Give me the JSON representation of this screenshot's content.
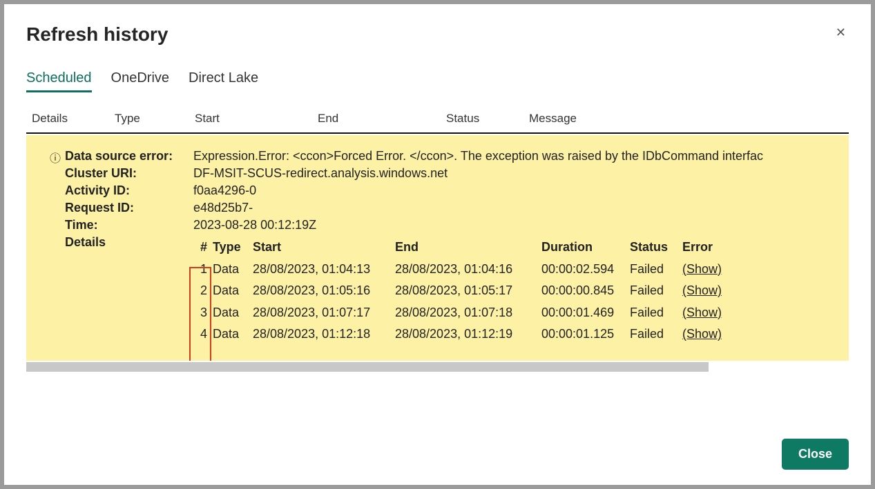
{
  "title": "Refresh history",
  "tabs": {
    "scheduled": "Scheduled",
    "onedrive": "OneDrive",
    "directlake": "Direct Lake"
  },
  "columns": {
    "details": "Details",
    "type": "Type",
    "start": "Start",
    "end": "End",
    "status": "Status",
    "message": "Message"
  },
  "error": {
    "labels": {
      "dse": "Data source error:",
      "cluster": "Cluster URI:",
      "activity": "Activity ID:",
      "request": "Request ID:",
      "time": "Time:",
      "details": "Details"
    },
    "values": {
      "dse": "Expression.Error: <ccon>Forced Error. </ccon>. The exception was raised by the IDbCommand interfac",
      "cluster": "DF-MSIT-SCUS-redirect.analysis.windows.net",
      "activity": "f0aa4296-0",
      "request": "e48d25b7-",
      "time": "2023-08-28 00:12:19Z"
    },
    "table": {
      "head": {
        "num": "#",
        "type": "Type",
        "start": "Start",
        "end": "End",
        "dur": "Duration",
        "stat": "Status",
        "err": "Error"
      },
      "rows": [
        {
          "num": "1",
          "type": "Data",
          "start": "28/08/2023, 01:04:13",
          "end": "28/08/2023, 01:04:16",
          "dur": "00:00:02.594",
          "stat": "Failed",
          "err": "(Show)"
        },
        {
          "num": "2",
          "type": "Data",
          "start": "28/08/2023, 01:05:16",
          "end": "28/08/2023, 01:05:17",
          "dur": "00:00:00.845",
          "stat": "Failed",
          "err": "(Show)"
        },
        {
          "num": "3",
          "type": "Data",
          "start": "28/08/2023, 01:07:17",
          "end": "28/08/2023, 01:07:18",
          "dur": "00:00:01.469",
          "stat": "Failed",
          "err": "(Show)"
        },
        {
          "num": "4",
          "type": "Data",
          "start": "28/08/2023, 01:12:18",
          "end": "28/08/2023, 01:12:19",
          "dur": "00:00:01.125",
          "stat": "Failed",
          "err": "(Show)"
        }
      ]
    }
  },
  "closeBtn": "Close"
}
